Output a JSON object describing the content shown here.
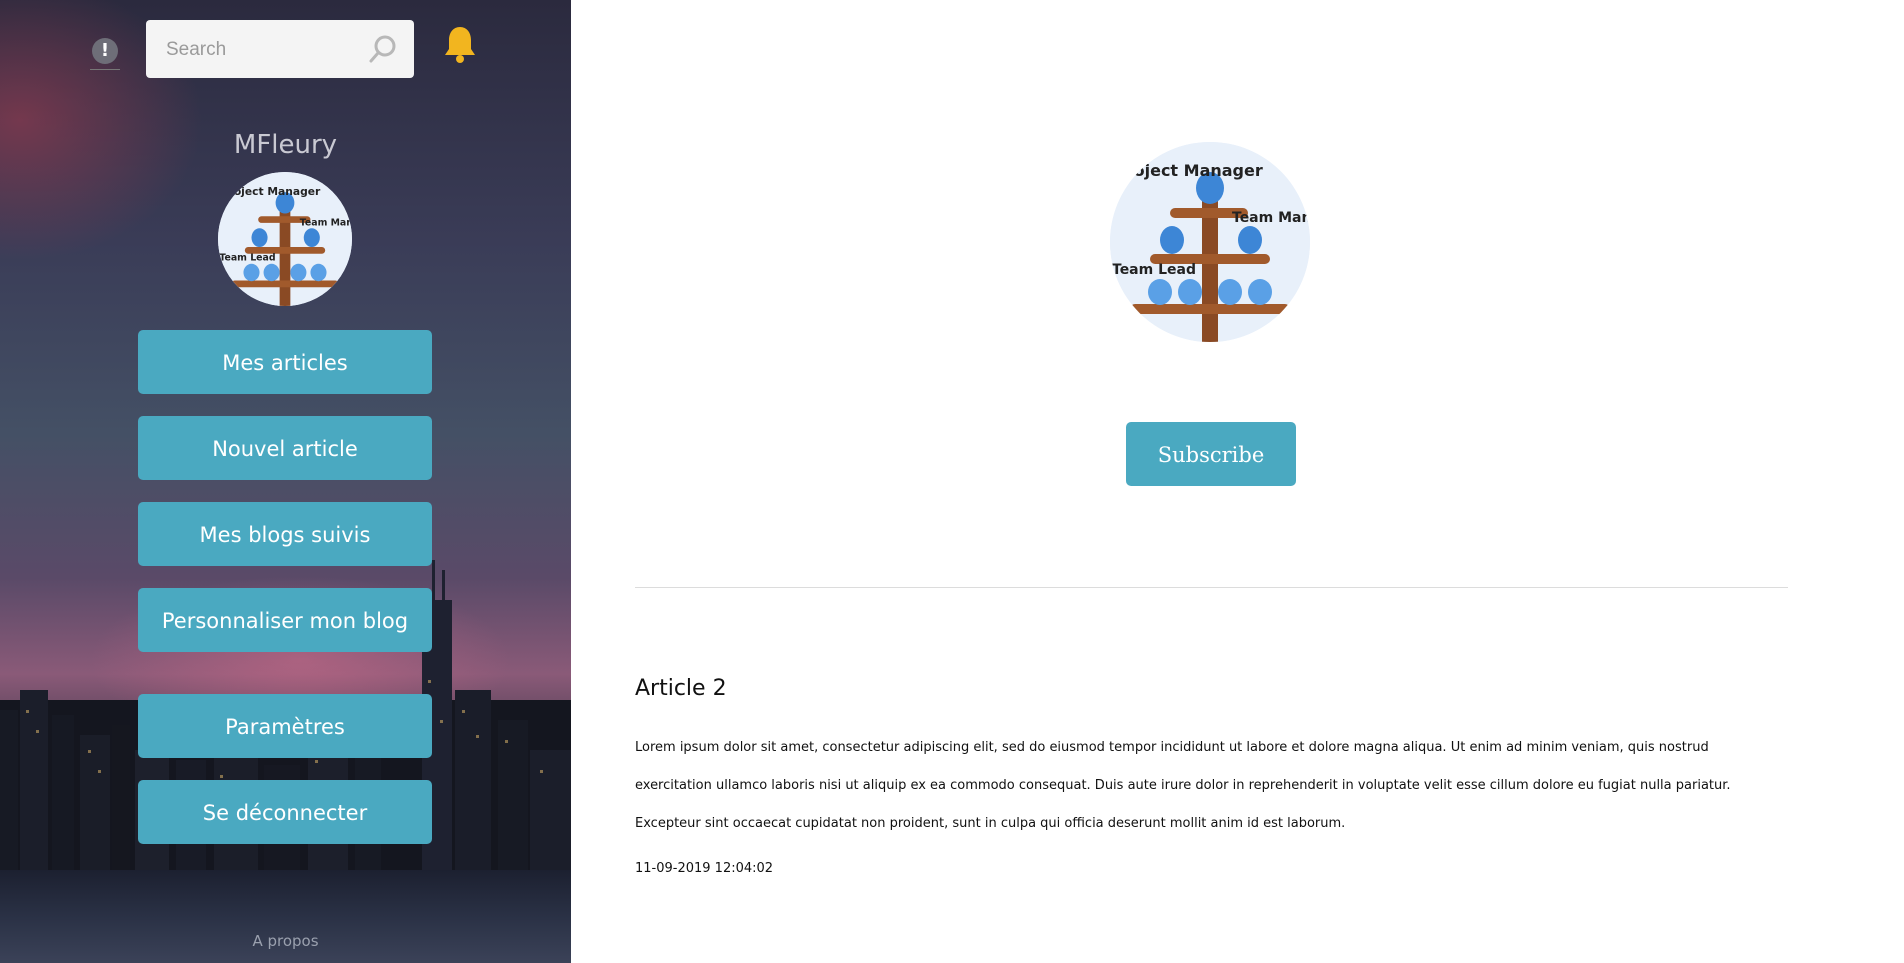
{
  "sidebar": {
    "search_placeholder": "Search",
    "username": "MFleury",
    "buttons": {
      "my_articles": "Mes articles",
      "new_article": "Nouvel article",
      "followed_blogs": "Mes blogs suivis",
      "customize_blog": "Personnaliser mon blog",
      "settings": "Paramètres",
      "logout": "Se déconnecter"
    },
    "about": "A propos"
  },
  "main": {
    "subscribe_label": "Subscribe",
    "article": {
      "title": "Article 2",
      "body": "Lorem ipsum dolor sit amet, consectetur adipiscing elit, sed do eiusmod tempor incididunt ut labore et dolore magna aliqua. Ut enim ad minim veniam, quis nostrud exercitation ullamco laboris nisi ut aliquip ex ea commodo consequat. Duis aute irure dolor in reprehenderit in voluptate velit esse cillum dolore eu fugiat nulla pariatur. Excepteur sint occaecat cupidatat non proident, sunt in culpa qui officia deserunt mollit anim id est laborum.",
      "date": "11-09-2019 12:04:02"
    }
  },
  "avatar_labels": {
    "a": "Project Manager",
    "b": "Team Manager",
    "c": "Team Lead"
  },
  "colors": {
    "accent": "#4aa9c1",
    "bell": "#f2b51f"
  }
}
